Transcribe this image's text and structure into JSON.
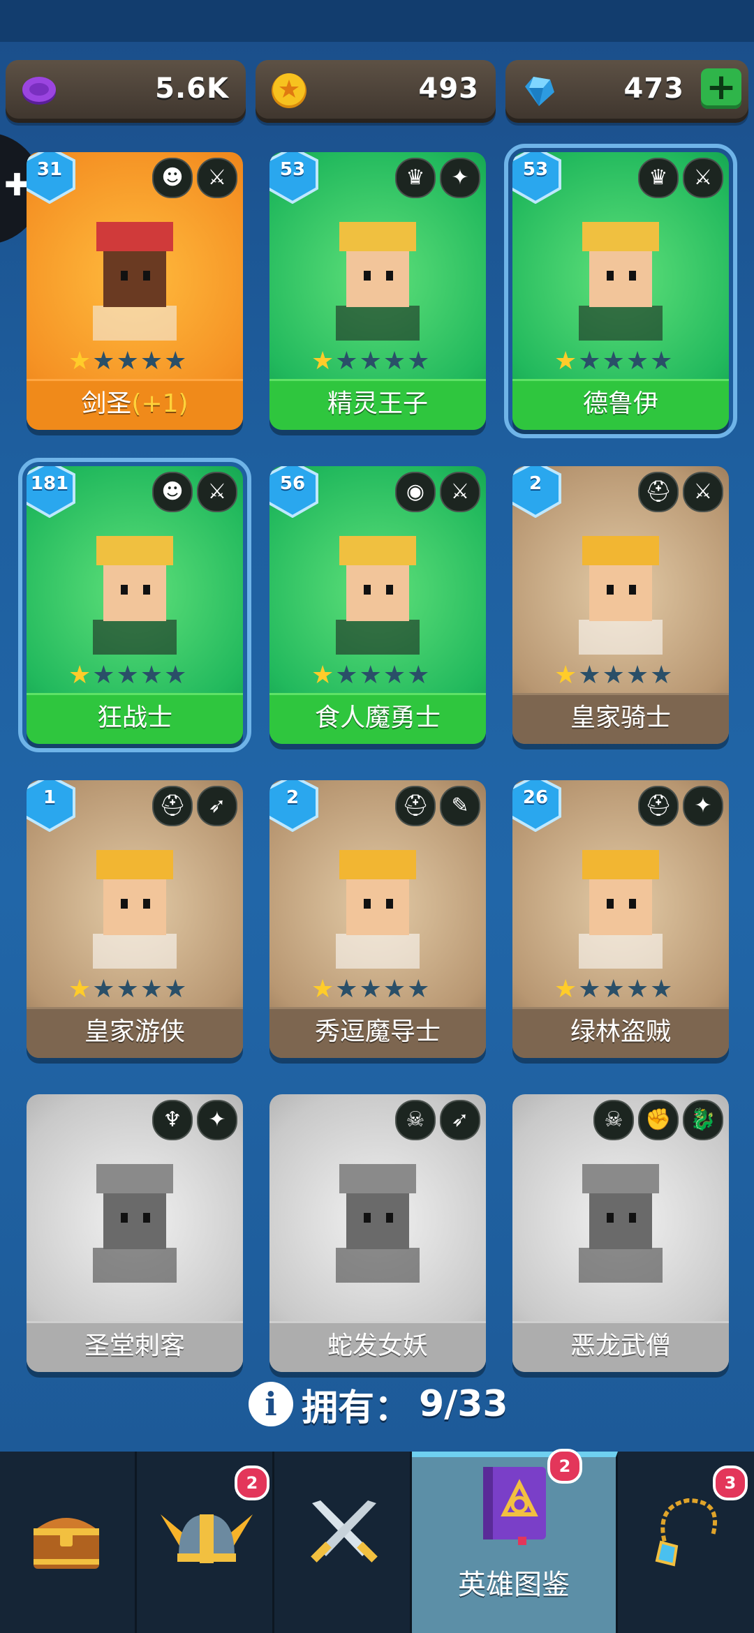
{
  "currencies": [
    {
      "name": "purple-token",
      "value": "5.6K",
      "color": "#8a3ad0"
    },
    {
      "name": "gold-coin",
      "value": "493",
      "color": "#f6b41f"
    },
    {
      "name": "gem",
      "value": "473",
      "color": "#3bb7f2"
    }
  ],
  "add_button_label": "+",
  "heroes": [
    {
      "name": "剑圣",
      "bonus": "(+1)",
      "level": "31",
      "stars": 1,
      "rarity": "orange",
      "classes": [
        "ogre-icon",
        "sword-icon"
      ]
    },
    {
      "name": "精灵王子",
      "level": "53",
      "stars": 1,
      "rarity": "green",
      "classes": [
        "elf-icon",
        "dagger-icon"
      ]
    },
    {
      "name": "德鲁伊",
      "level": "53",
      "stars": 1,
      "rarity": "green",
      "classes": [
        "elf-icon",
        "sword-icon"
      ]
    },
    {
      "name": "狂战士",
      "level": "181",
      "stars": 1,
      "rarity": "green",
      "classes": [
        "ogre-icon",
        "sword-icon"
      ]
    },
    {
      "name": "食人魔勇士",
      "level": "56",
      "stars": 1,
      "rarity": "green",
      "classes": [
        "cyclops-icon",
        "sword-icon"
      ]
    },
    {
      "name": "皇家骑士",
      "level": "2",
      "stars": 1,
      "rarity": "brown",
      "classes": [
        "helmet-icon",
        "sword-icon"
      ]
    },
    {
      "name": "皇家游侠",
      "level": "1",
      "stars": 1,
      "rarity": "brown",
      "classes": [
        "helmet-icon",
        "bow-icon"
      ]
    },
    {
      "name": "秀逗魔导士",
      "level": "2",
      "stars": 1,
      "rarity": "brown",
      "classes": [
        "helmet-icon",
        "staff-icon"
      ]
    },
    {
      "name": "绿林盗贼",
      "level": "26",
      "stars": 1,
      "rarity": "brown",
      "classes": [
        "helmet-icon",
        "dagger-icon"
      ]
    },
    {
      "name": "圣堂刺客",
      "level": "",
      "stars": 0,
      "rarity": "gray",
      "classes": [
        "winged-icon",
        "dagger-icon"
      ]
    },
    {
      "name": "蛇发女妖",
      "level": "",
      "stars": 0,
      "rarity": "gray",
      "classes": [
        "skull-icon",
        "bow-icon"
      ]
    },
    {
      "name": "恶龙武僧",
      "level": "",
      "stars": 0,
      "rarity": "gray",
      "classes": [
        "skull-icon",
        "fist-icon",
        "dragon-icon"
      ]
    }
  ],
  "owned": {
    "label": "拥有：",
    "count": "9/33"
  },
  "nav": [
    {
      "name": "chest-tab",
      "icon": "chest-icon",
      "badge": ""
    },
    {
      "name": "heroes-tab",
      "icon": "viking-helmet-icon",
      "badge": "2"
    },
    {
      "name": "battle-tab",
      "icon": "crossed-swords-icon",
      "badge": ""
    },
    {
      "name": "codex-tab",
      "icon": "spellbook-icon",
      "badge": "2",
      "label": "英雄图鉴",
      "active": true
    },
    {
      "name": "amulet-tab",
      "icon": "amulet-icon",
      "badge": "3"
    }
  ]
}
